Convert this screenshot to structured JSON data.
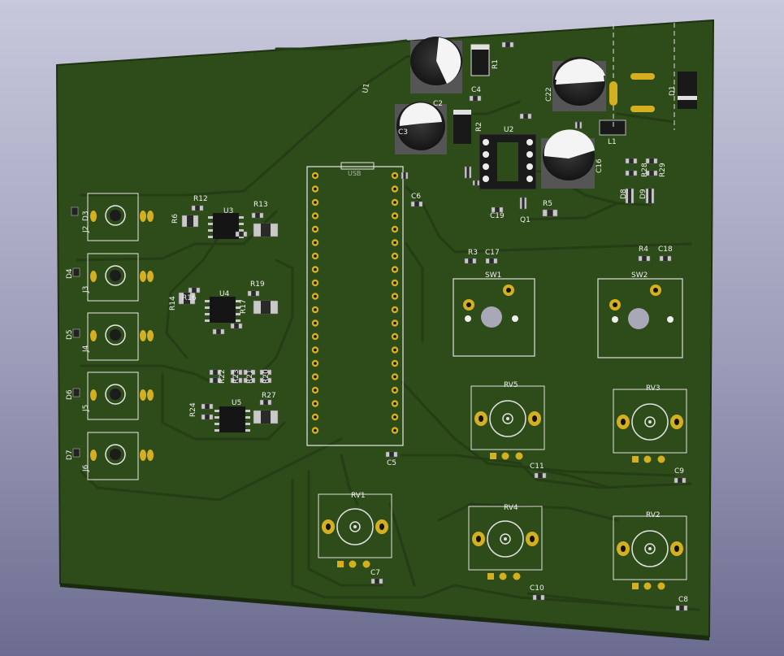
{
  "board": {
    "silk_color": "#f0f0f0",
    "board_color": "#2e4b1a",
    "copper_color": "#d4b020"
  },
  "labels": {
    "usb": "USB",
    "u1": "U1",
    "u2": "U2",
    "u3": "U3",
    "u4": "U4",
    "u5": "U5",
    "c2": "C2",
    "c3": "C3",
    "c4": "C4",
    "c5": "C5",
    "c6": "C6",
    "c7": "C7",
    "c8": "C8",
    "c9": "C9",
    "c10": "C10",
    "c11": "C11",
    "c16": "C16",
    "c17": "C17",
    "c18": "C18",
    "c19": "C19",
    "c22": "C22",
    "r1": "R1",
    "r2": "R2",
    "r3": "R3",
    "r4": "R4",
    "r5": "R5",
    "r6": "R6",
    "r12": "R12",
    "r13": "R13",
    "r14": "R14",
    "r16": "R16",
    "r17": "R17",
    "r19": "R19",
    "r20": "R20",
    "r21": "R21",
    "r22": "R22",
    "r23": "R23",
    "r24": "R24",
    "r27": "R27",
    "r28": "R28",
    "r29": "R29",
    "q1": "Q1",
    "l1": "L1",
    "d1": "D1",
    "d3": "D3",
    "d4": "D4",
    "d5": "D5",
    "d6": "D6",
    "d7": "D7",
    "d8": "D8",
    "d9": "D9",
    "j2": "J2",
    "j3": "J3",
    "j4": "J4",
    "j5": "J5",
    "j6": "J6",
    "sw1": "SW1",
    "sw2": "SW2",
    "rv1": "RV1",
    "rv2": "RV2",
    "rv3": "RV3",
    "rv4": "RV4",
    "rv5": "RV5"
  }
}
